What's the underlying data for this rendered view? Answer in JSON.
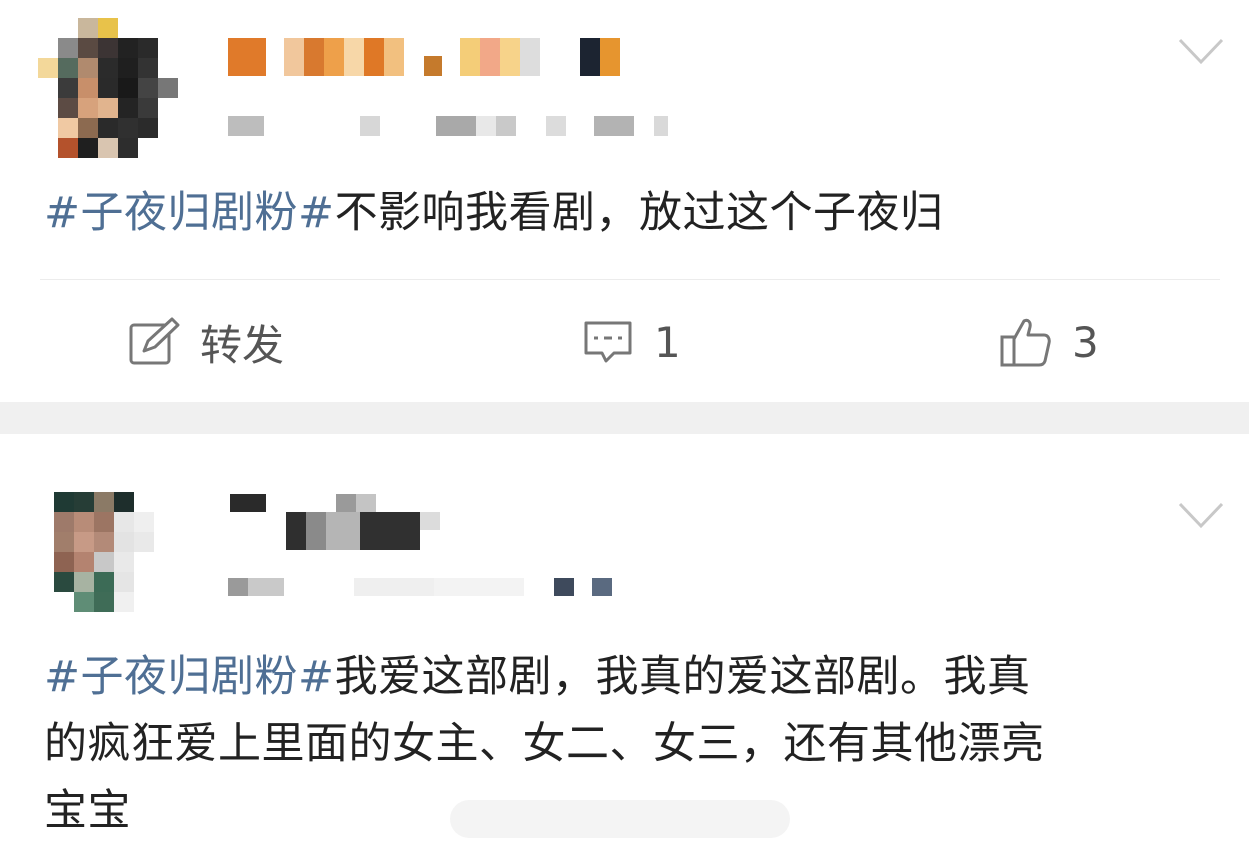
{
  "posts": [
    {
      "text_topic": "#子夜归剧粉#",
      "text_body": "不影响我看剧，放过这个子夜归",
      "actions": {
        "repost_label": "转发",
        "comment_count": "1",
        "like_count": "3"
      }
    },
    {
      "text_topic": "#子夜归剧粉#",
      "text_line1_rest": "我爱这部剧，我真的爱这部剧。我真",
      "text_line2": "的疯狂爱上里面的女主、女二、女三，还有其他漂亮",
      "text_line3": "宝宝"
    }
  ],
  "colors": {
    "topic": "#4f6f94",
    "text": "#222222",
    "action": "#555555",
    "separator": "#f0f0f0"
  },
  "icons": [
    "repost-icon",
    "comment-icon",
    "like-icon",
    "chevron-down-icon"
  ]
}
